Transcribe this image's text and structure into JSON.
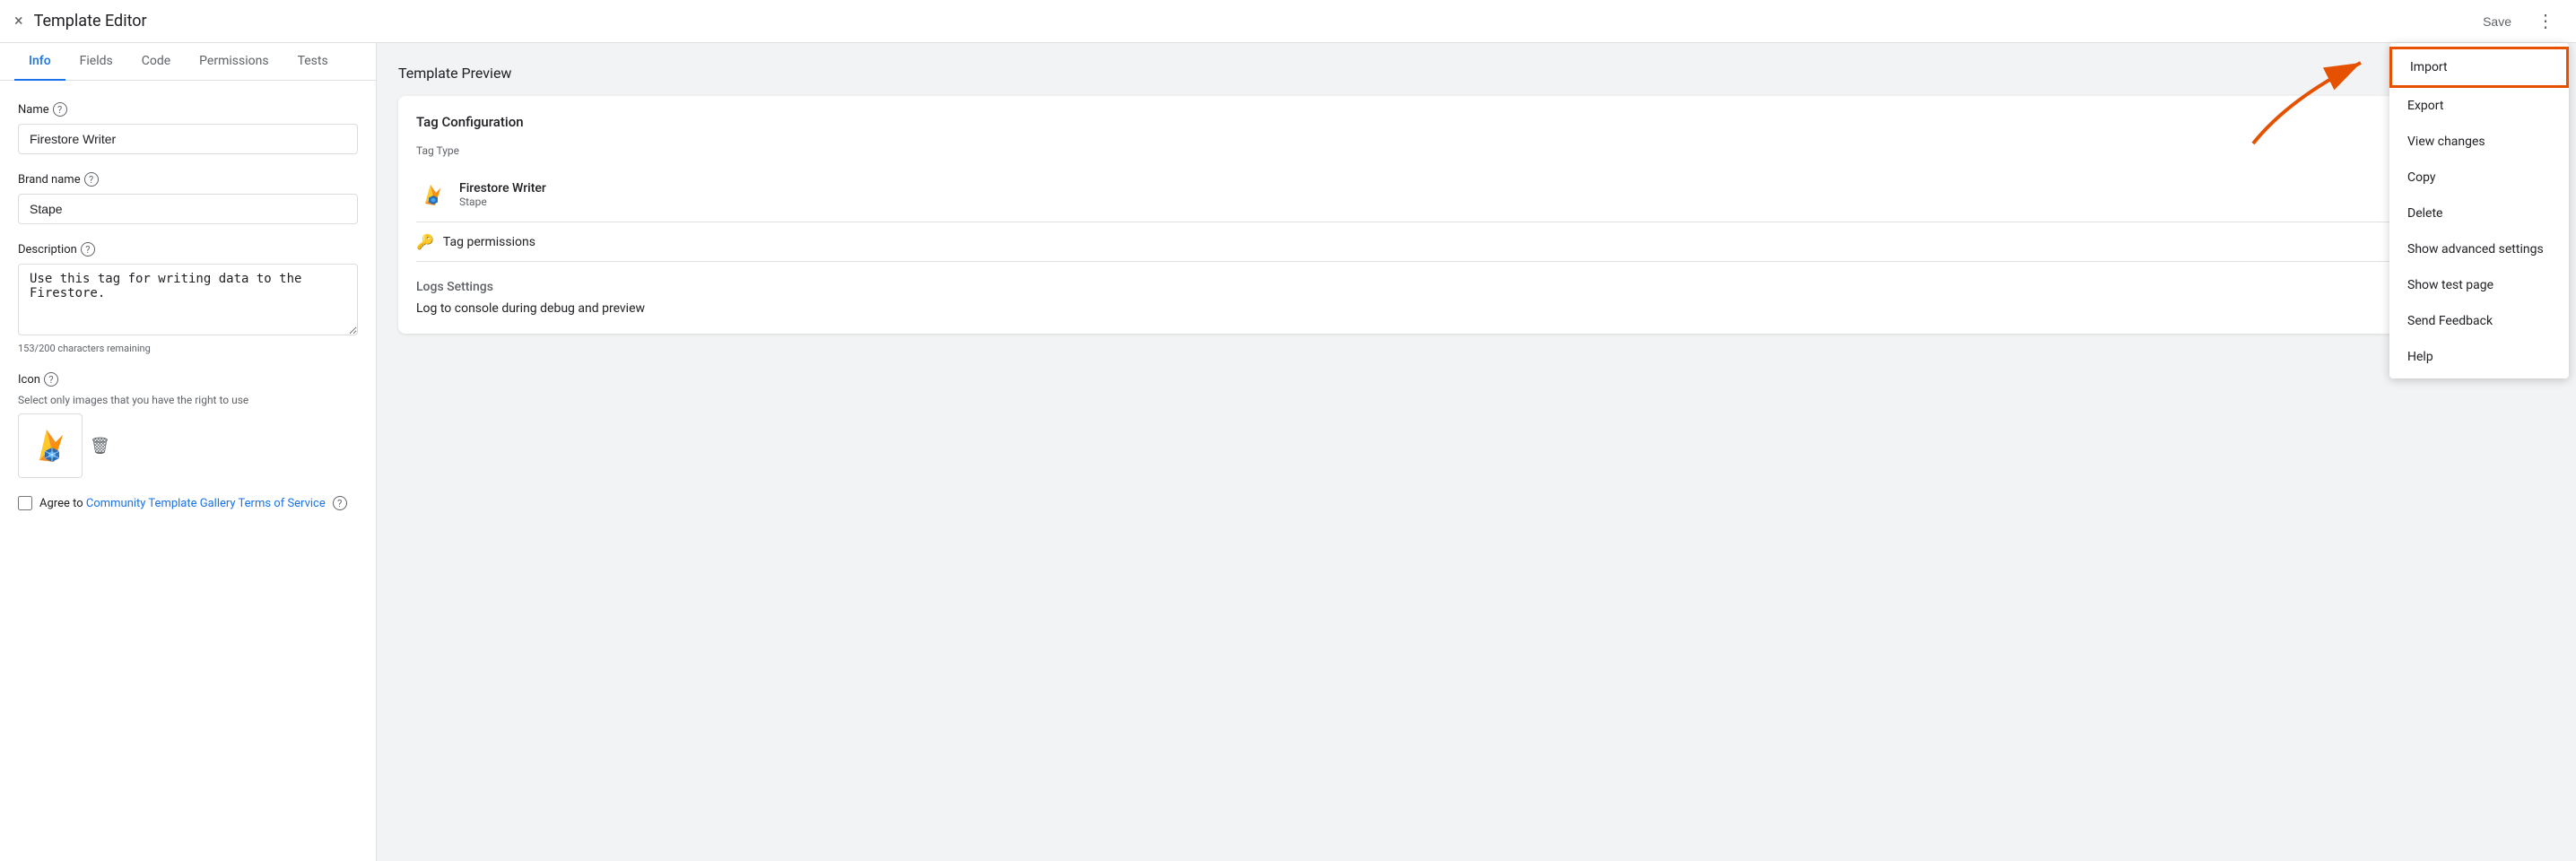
{
  "topBar": {
    "title": "Template Editor",
    "saveLabel": "Save",
    "closeIcon": "×",
    "moreIcon": "⋮"
  },
  "tabs": [
    {
      "label": "Info",
      "active": true
    },
    {
      "label": "Fields",
      "active": false
    },
    {
      "label": "Code",
      "active": false
    },
    {
      "label": "Permissions",
      "active": false
    },
    {
      "label": "Tests",
      "active": false
    }
  ],
  "form": {
    "nameLabel": "Name",
    "nameValue": "Firestore Writer",
    "brandNameLabel": "Brand name",
    "brandNameValue": "Stape",
    "descriptionLabel": "Description",
    "descriptionValue": "Use this tag for writing data to the Firestore.",
    "charCount": "153/200 characters remaining",
    "iconLabel": "Icon",
    "iconSubLabel": "Select only images that you have the right to use",
    "checkboxLabel": "Agree to",
    "linkText": "Community Template Gallery Terms of Service"
  },
  "preview": {
    "title": "Template Preview",
    "card": {
      "sectionTitle": "Tag Configuration",
      "tagTypeLabel": "Tag Type",
      "tagName": "Firestore Writer",
      "tagBrand": "Stape",
      "permissionsLabel": "Tag permissions",
      "logsSectionTitle": "Logs Settings",
      "logsValue": "Log to console during debug and preview"
    }
  },
  "dropdown": {
    "items": [
      {
        "label": "Import",
        "highlighted": true
      },
      {
        "label": "Export"
      },
      {
        "label": "View changes"
      },
      {
        "label": "Copy"
      },
      {
        "label": "Delete"
      },
      {
        "label": "Show advanced settings"
      },
      {
        "label": "Show test page"
      },
      {
        "label": "Send Feedback"
      },
      {
        "label": "Help"
      }
    ]
  },
  "colors": {
    "activeTab": "#1a73e8",
    "linkColor": "#1a73e8",
    "arrowColor": "#e65100",
    "highlightBorder": "#e65100"
  }
}
